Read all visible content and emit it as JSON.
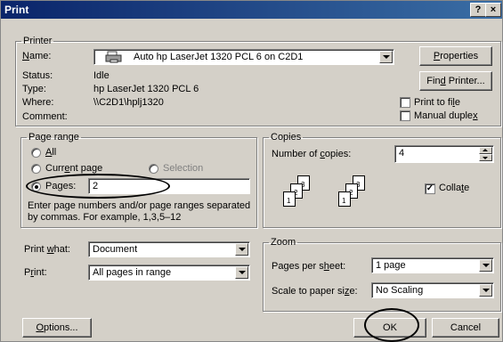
{
  "window": {
    "title": "Print",
    "help": "?",
    "close": "×"
  },
  "printer": {
    "legend": "Printer",
    "name_label": "Name:",
    "name_value": "Auto hp LaserJet 1320 PCL 6 on C2D1",
    "status_label": "Status:",
    "status_value": "Idle",
    "type_label": "Type:",
    "type_value": "hp LaserJet 1320 PCL 6",
    "where_label": "Where:",
    "where_value": "\\\\C2D1\\hplj1320",
    "comment_label": "Comment:",
    "properties_button": "Properties",
    "find_printer_button": "Find Printer...",
    "print_to_file_label": "Print to file",
    "print_to_file_checked": false,
    "manual_duplex_label": "Manual duplex",
    "manual_duplex_checked": false
  },
  "page_range": {
    "legend": "Page range",
    "all_label": "All",
    "current_page_label": "Current page",
    "selection_label": "Selection",
    "pages_label": "Pages:",
    "pages_value": "2",
    "selected": "pages",
    "hint": "Enter page numbers and/or page ranges separated by commas.  For example, 1,3,5–12"
  },
  "copies": {
    "legend": "Copies",
    "number_label": "Number of copies:",
    "number_value": "4",
    "collate_label": "Collate",
    "collate_checked": true,
    "page_numbers": [
      "3",
      "2",
      "1",
      "3",
      "2",
      "1"
    ]
  },
  "print_what": {
    "label": "Print what:",
    "value": "Document"
  },
  "print": {
    "label": "Print:",
    "value": "All pages in range"
  },
  "zoom": {
    "legend": "Zoom",
    "pages_per_sheet_label": "Pages per sheet:",
    "pages_per_sheet_value": "1 page",
    "scale_label": "Scale to paper size:",
    "scale_value": "No Scaling"
  },
  "footer": {
    "options_button": "Options...",
    "ok_button": "OK",
    "cancel_button": "Cancel"
  }
}
